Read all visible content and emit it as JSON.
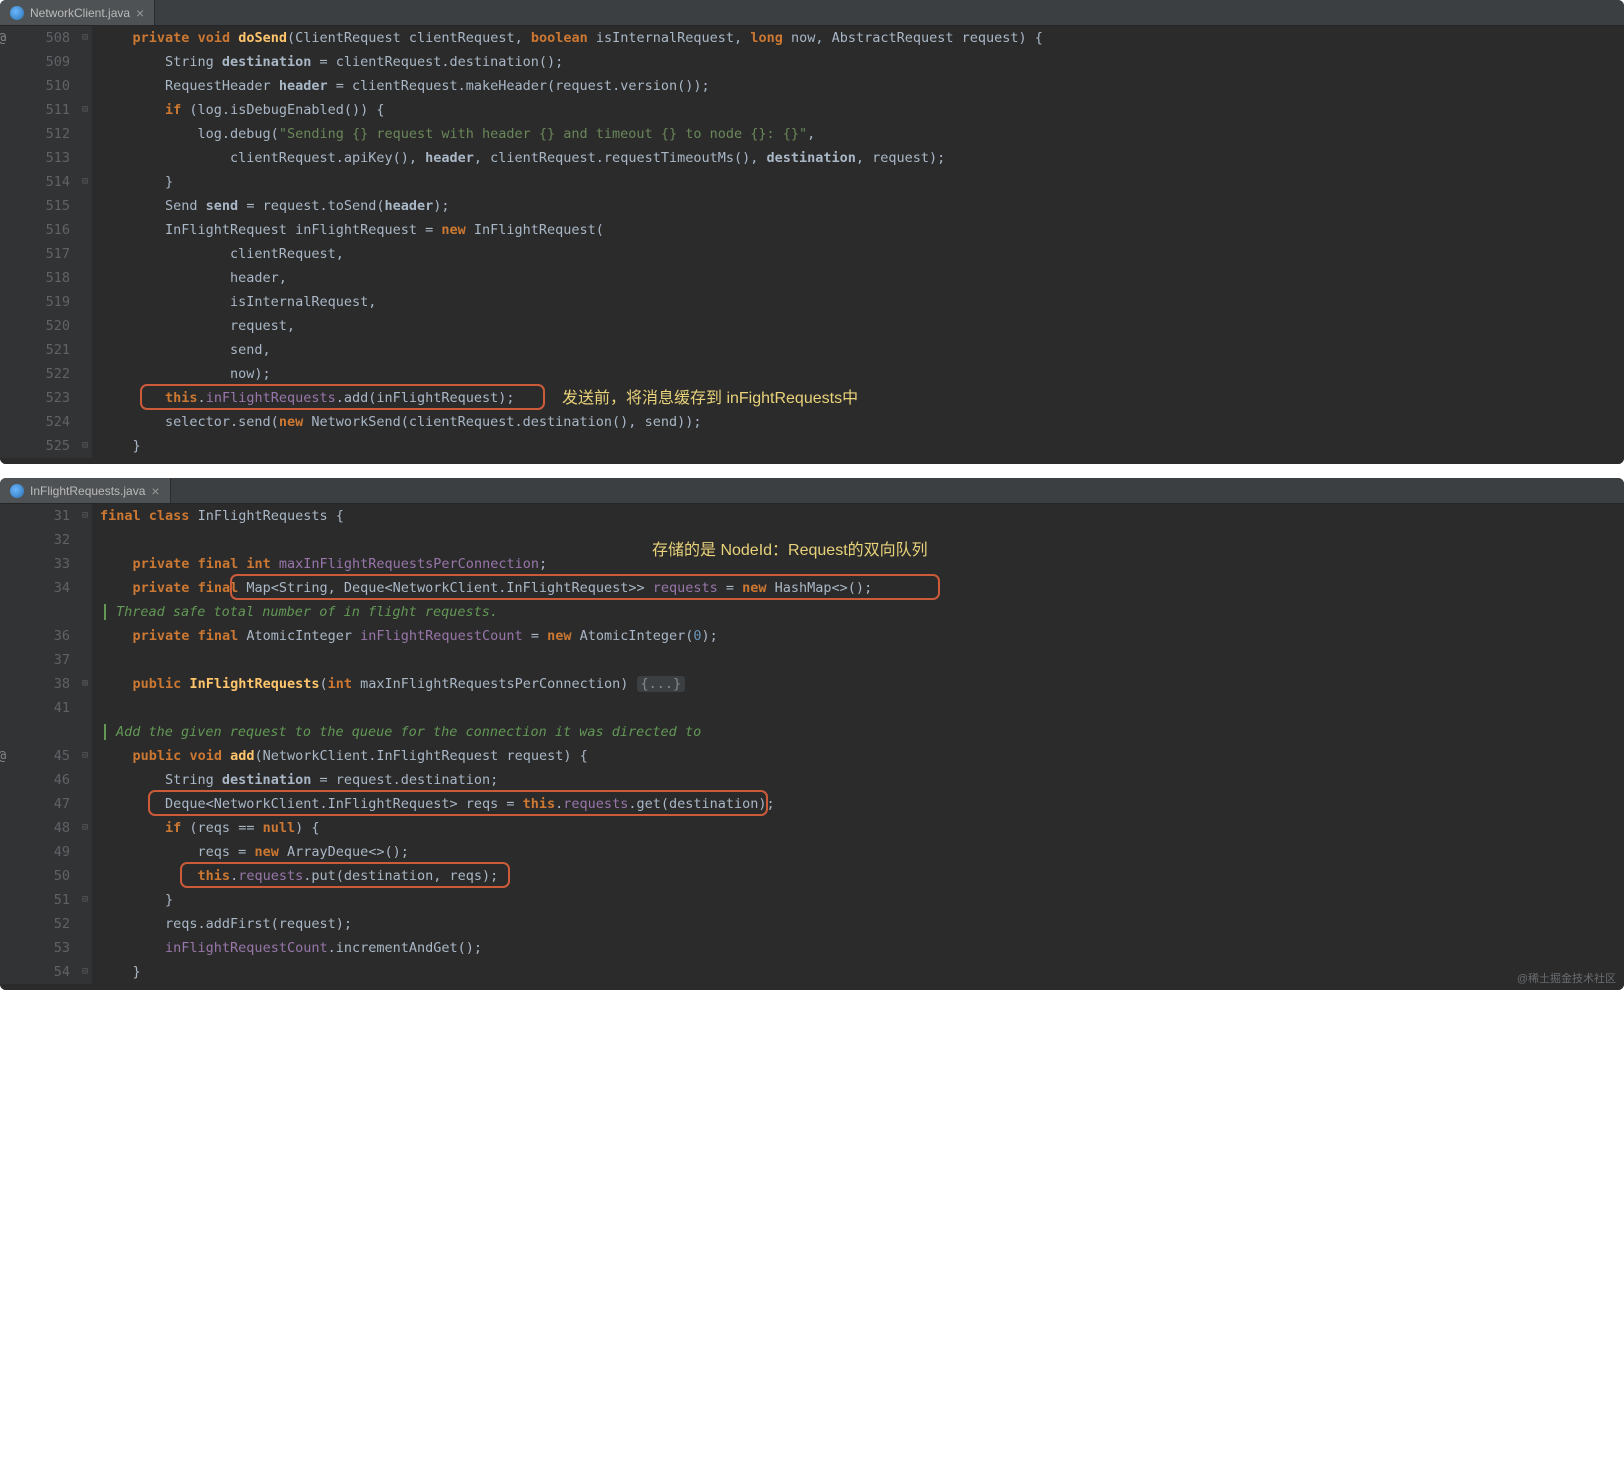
{
  "watermark": "@稀土掘金技术社区",
  "pane1": {
    "tab": "NetworkClient.java",
    "lines": {
      "start": 508,
      "numbers": [
        "508",
        "509",
        "510",
        "511",
        "512",
        "513",
        "514",
        "515",
        "516",
        "517",
        "518",
        "519",
        "520",
        "521",
        "522",
        "523",
        "524",
        "525"
      ]
    },
    "annot1": "发送前，将消息缓存到 inFightRequests中"
  },
  "pane2": {
    "tab": "InFlightRequests.java",
    "lines": {
      "numbers": [
        "31",
        "32",
        "33",
        "34",
        "",
        "36",
        "37",
        "38",
        "41",
        "",
        "45",
        "46",
        "47",
        "48",
        "49",
        "50",
        "51",
        "52",
        "53",
        "54"
      ]
    },
    "annot1": "存储的是 NodeId：Request的双向队列",
    "doc1": "Thread safe total number of in flight requests.",
    "doc2": "Add the given request to the queue for the connection it was directed to"
  },
  "code1": {
    "l508": {
      "pre": "    ",
      "kw1": "private",
      "kw2": "void",
      "m": "doSend",
      "args_a": "(ClientRequest clientRequest, ",
      "kw3": "boolean",
      "args_b": " isInternalRequest, ",
      "kw4": "long",
      "args_c": " now, AbstractRequest request) {"
    },
    "l509": "        String destination = clientRequest.destination();",
    "l510": "        RequestHeader header = clientRequest.makeHeader(request.version());",
    "l511": {
      "pre": "        ",
      "kw": "if",
      "rest": " (log.isDebugEnabled()) {"
    },
    "l512": {
      "pre": "            log.debug(",
      "str": "\"Sending {} request with header {} and timeout {} to node {}: {}\"",
      "post": ","
    },
    "l513": "                clientRequest.apiKey(), header, clientRequest.requestTimeoutMs(), destination, request);",
    "l514": "        }",
    "l515": "        Send send = request.toSend(header);",
    "l516": {
      "pre": "        InFlightRequest inFlightRequest = ",
      "kw": "new",
      "rest": " InFlightRequest("
    },
    "l517": "                clientRequest,",
    "l518": "                header,",
    "l519": "                isInternalRequest,",
    "l520": "                request,",
    "l521": "                send,",
    "l522": "                now);",
    "l523": {
      "pre": "        ",
      "kw": "this",
      "rest": ".inFlightRequests.add(inFlightRequest);"
    },
    "l524": {
      "pre": "        selector.send(",
      "kw": "new",
      "rest": " NetworkSend(clientRequest.destination(), send));"
    },
    "l525": "    }"
  },
  "code2": {
    "l31": {
      "kw1": "final",
      "kw2": "class",
      "cls": "InFlightRequests",
      "rest": " {"
    },
    "l33": {
      "pre": "    ",
      "kw1": "private",
      "kw2": "final",
      "kw3": "int",
      "field": "maxInFlightRequestsPerConnection",
      "post": ";"
    },
    "l34": {
      "pre": "    ",
      "kw1": "private",
      "kw2": "final",
      "type": " Map<String, Deque<NetworkClient.InFlightRequest>> ",
      "field": "requests",
      "eq": " = ",
      "kw3": "new",
      "rest": " HashMap<>();"
    },
    "l36": {
      "pre": "    ",
      "kw1": "private",
      "kw2": "final",
      "type": " AtomicInteger ",
      "field": "inFlightRequestCount",
      "eq": " = ",
      "kw3": "new",
      "rest": " AtomicInteger(",
      "num": "0",
      "post": ");"
    },
    "l38": {
      "pre": "    ",
      "kw": "public",
      "m": "InFlightRequests",
      "args": "(",
      "kw2": "int",
      "rest": " maxInFlightRequestsPerConnection) ",
      "folded": "{...}"
    },
    "l45": {
      "pre": "    ",
      "kw1": "public",
      "kw2": "void",
      "m": "add",
      "args": "(NetworkClient.InFlightRequest request) {"
    },
    "l46": {
      "pre": "        String ",
      "var": "destination",
      "rest": " = request.destination;"
    },
    "l47": {
      "pre": "        Deque<NetworkClient.InFlightRequest> reqs = ",
      "kw": "this",
      "rest": ".requests.get(destination);"
    },
    "l48": {
      "pre": "        ",
      "kw": "if",
      "rest": " (reqs == ",
      "kw2": "null",
      "post": ") {"
    },
    "l49": {
      "pre": "            reqs = ",
      "kw": "new",
      "rest": " ArrayDeque<>();"
    },
    "l50": {
      "pre": "            ",
      "kw": "this",
      "rest": ".requests.put(destination, reqs);"
    },
    "l51": "        }",
    "l52": "        reqs.addFirst(request);",
    "l53": "        inFlightRequestCount.incrementAndGet();",
    "l54": "    }"
  }
}
